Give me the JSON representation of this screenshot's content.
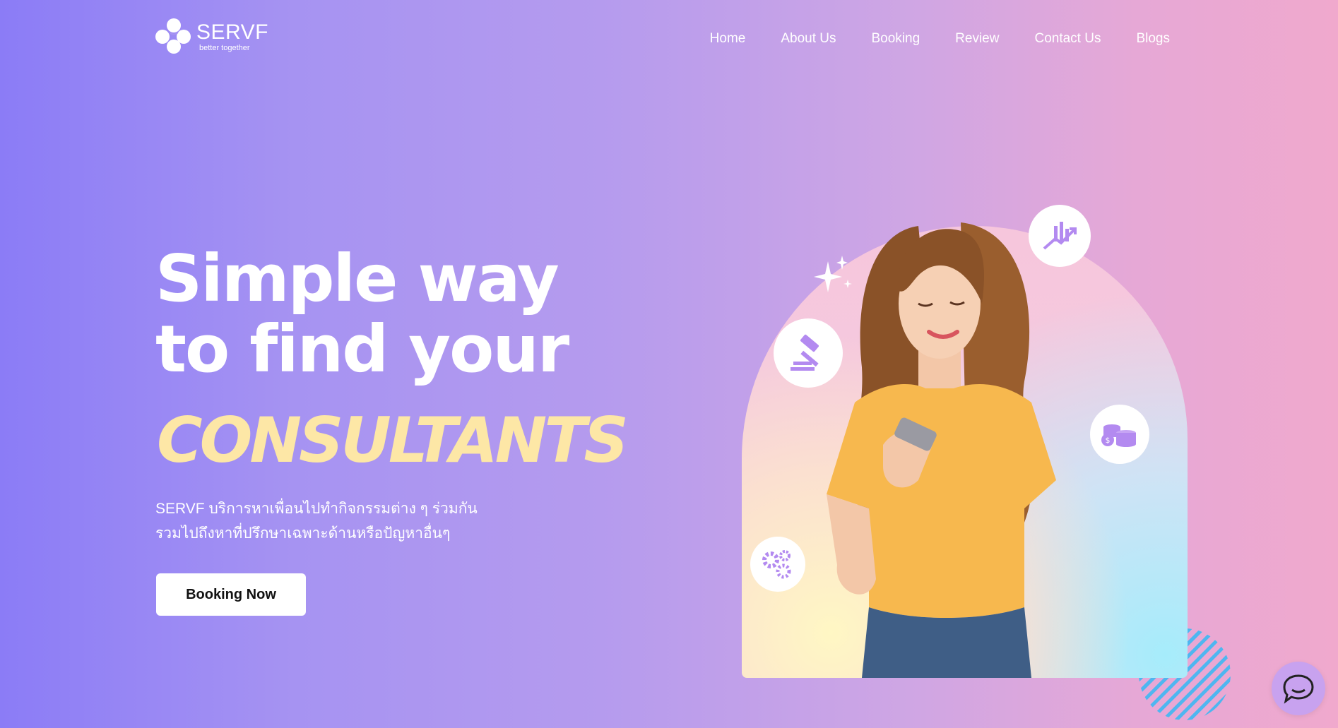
{
  "brand": {
    "name": "SERVF",
    "tagline": "better together"
  },
  "nav": {
    "items": [
      {
        "label": "Home"
      },
      {
        "label": "About Us"
      },
      {
        "label": "Booking"
      },
      {
        "label": "Review"
      },
      {
        "label": "Contact Us"
      },
      {
        "label": "Blogs"
      }
    ]
  },
  "hero": {
    "headline_line1": "Simple way",
    "headline_line2": "to find your",
    "highlight": "CONSULTANTS",
    "description_line1": "SERVF บริการหาเพื่อนไปทำกิจกรรมต่าง ๆ ร่วมกัน",
    "description_line2": "รวมไปถึงหาที่ปรึกษาเฉพาะด้านหรือปัญหาอื่นๆ",
    "cta_label": "Booking Now"
  },
  "illustration": {
    "icons": [
      "growth-chart-icon",
      "gavel-icon",
      "coins-icon",
      "gears-icon",
      "sparkle-icon"
    ],
    "person": "woman-with-phone-photo"
  },
  "chat": {
    "icon": "chat-bubble-icon"
  },
  "colors": {
    "gradient_start": "#8b7cf6",
    "gradient_end": "#f0a9cd",
    "highlight": "#fde7a6",
    "icon_purple": "#b38af0",
    "stripe_blue": "#4fb6f0",
    "shirt_yellow": "#f7b84e"
  }
}
